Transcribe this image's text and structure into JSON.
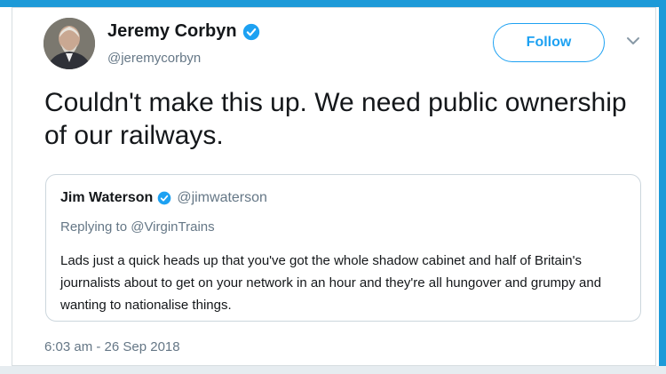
{
  "tweet": {
    "author_name": "Jeremy Corbyn",
    "author_handle": "@jeremycorbyn",
    "follow_label": "Follow",
    "text": "Couldn't make this up. We need public ownership of our railways.",
    "timestamp": "6:03 am - 26 Sep 2018"
  },
  "quoted_tweet": {
    "author_name": "Jim Waterson",
    "author_handle": "@jimwaterson",
    "reply_prefix": "Replying to",
    "reply_to": "@VirginTrains",
    "text": "Lads just a quick heads up that you've got the whole shadow cabinet and half of Britain's journalists about to get on your network in an hour and they're all hungover and grumpy and wanting to nationalise things."
  },
  "colors": {
    "accent": "#1da1f2",
    "frame": "#1d9ad8",
    "secondary_text": "#657786",
    "primary_text": "#14171a",
    "border": "#ccd6dd"
  },
  "icons": [
    "verified-badge-icon",
    "chevron-down-icon",
    "avatar-photo"
  ]
}
